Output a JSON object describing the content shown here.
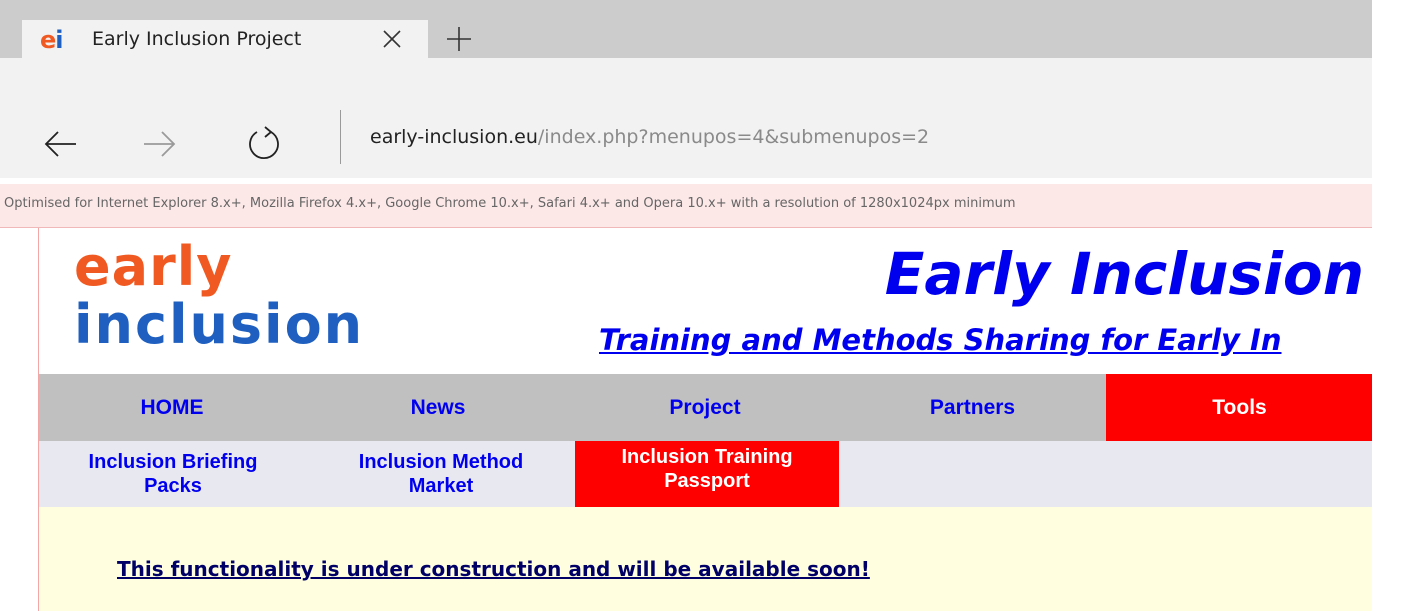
{
  "browser": {
    "tab": {
      "favicon_letters": [
        "e",
        "i"
      ],
      "title": "Early Inclusion Project"
    },
    "address": {
      "host": "early-inclusion.eu",
      "path": "/index.php?menupos=4&submenupos=2"
    }
  },
  "notice": {
    "text": "Optimised for Internet Explorer 8.x+, Mozilla Firefox 4.x+, Google Chrome 10.x+, Safari 4.x+ and Opera 10.x+ with a resolution of 1280x1024px minimum"
  },
  "header": {
    "logo_line1": "early",
    "logo_line2": "inclusion",
    "title": "Early Inclusion",
    "subtitle": "Training and Methods Sharing for Early In"
  },
  "main_menu": {
    "items": [
      {
        "label": "HOME",
        "active": false
      },
      {
        "label": "News",
        "active": false
      },
      {
        "label": "Project",
        "active": false
      },
      {
        "label": "Partners",
        "active": false
      },
      {
        "label": "Tools",
        "active": true
      }
    ]
  },
  "sub_menu": {
    "items": [
      {
        "line1": "Inclusion Briefing",
        "line2": "Packs",
        "active": false
      },
      {
        "line1": "Inclusion Method",
        "line2": "Market",
        "active": false
      },
      {
        "line1": "Inclusion Training",
        "line2": "Passport",
        "active": true
      }
    ]
  },
  "content": {
    "message": "This functionality is under construction and will be available soon!"
  },
  "colors": {
    "accent_red": "#ff0000",
    "link_blue": "#0000ee",
    "logo_orange": "#f05a22",
    "logo_blue": "#1f5fbf",
    "menu_gray": "#c0c0c0",
    "content_bg": "#ffffe0"
  },
  "icons": {
    "tab_close": "close-icon",
    "new_tab": "plus-icon",
    "back": "arrow-left-icon",
    "forward": "arrow-right-icon",
    "refresh": "refresh-icon"
  }
}
